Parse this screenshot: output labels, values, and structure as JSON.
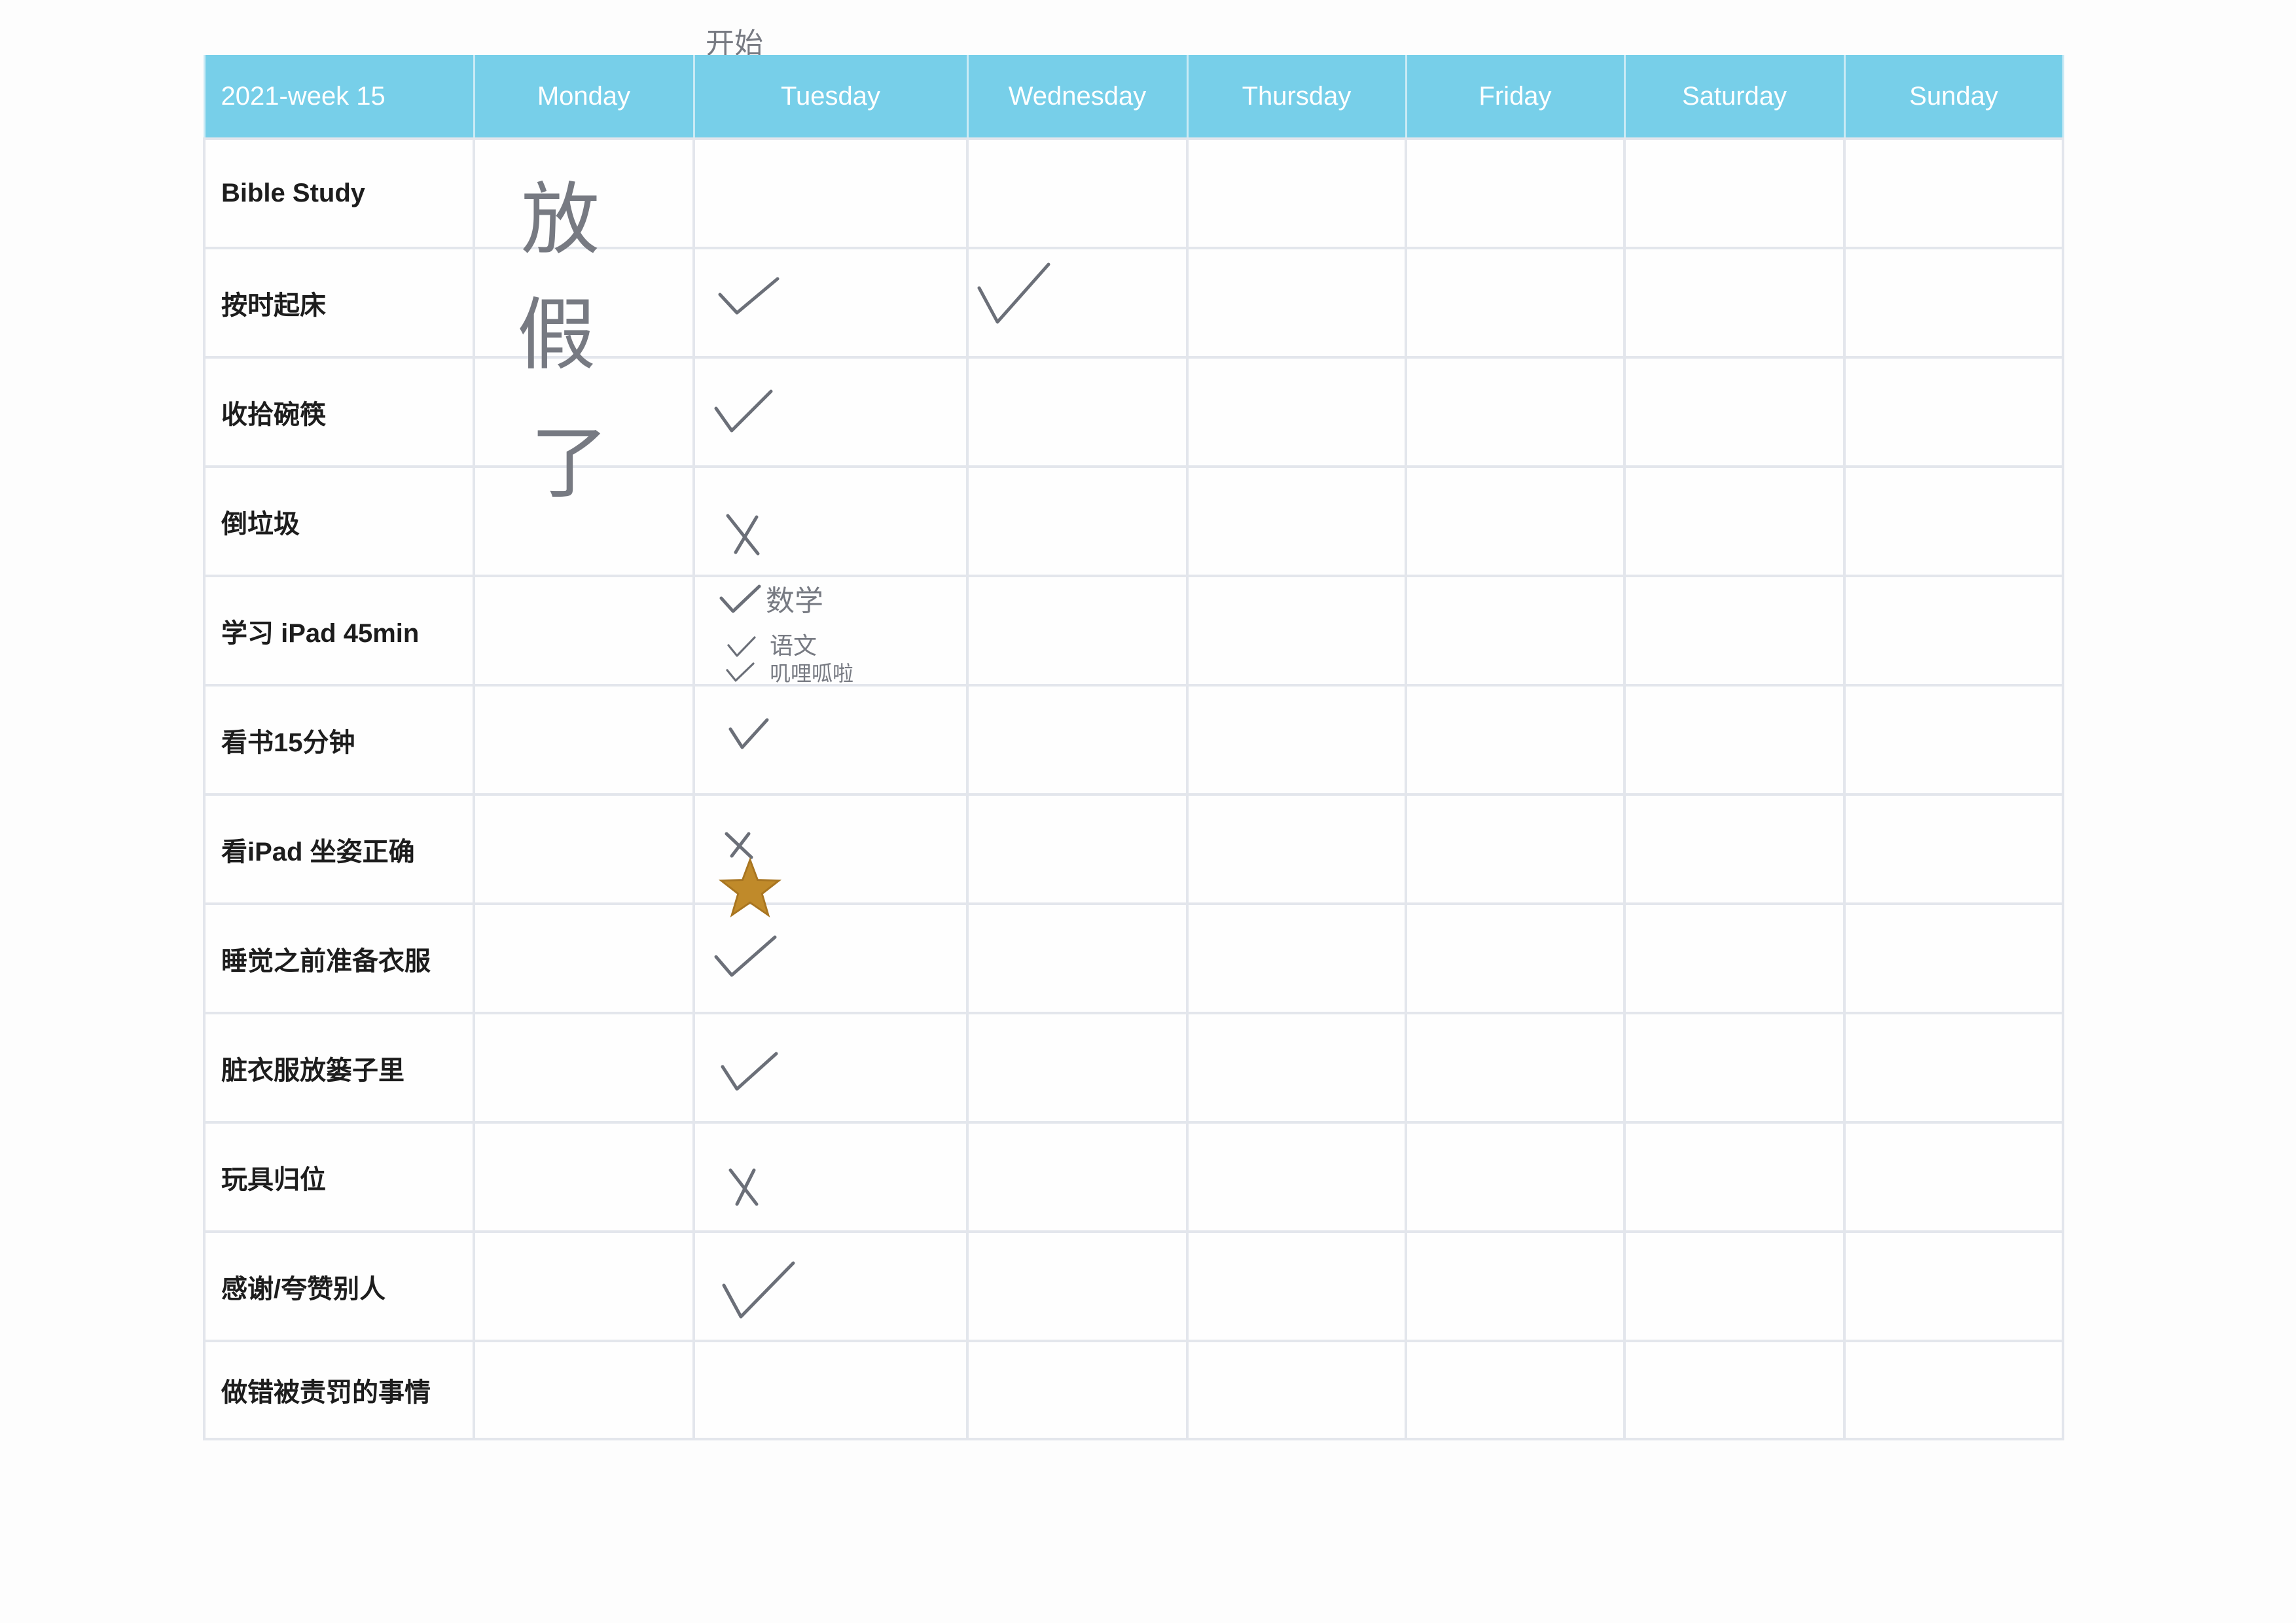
{
  "header": {
    "week": "2021-week 15",
    "days": [
      "Monday",
      "Tuesday",
      "Wednesday",
      "Thursday",
      "Friday",
      "Saturday",
      "Sunday"
    ]
  },
  "handwriting": {
    "top_note": "开始",
    "monday_note": [
      "放",
      "假",
      "了"
    ],
    "ipad_subjects": [
      "数学",
      "语文",
      "叽哩呱啦"
    ]
  },
  "rows": [
    {
      "label": "Bible Study",
      "monday": "放",
      "tuesday": "",
      "wednesday": ""
    },
    {
      "label": " 按时起床",
      "monday": "假",
      "tuesday": "check",
      "wednesday": "check"
    },
    {
      "label": "收拾碗筷",
      "monday": "了",
      "tuesday": "check",
      "wednesday": ""
    },
    {
      "label": "倒垃圾",
      "monday": "",
      "tuesday": "cross",
      "wednesday": ""
    },
    {
      "label": "学习 iPad 45min",
      "monday": "",
      "tuesday": "check x3",
      "wednesday": ""
    },
    {
      "label": "看书15分钟",
      "monday": "",
      "tuesday": "check",
      "wednesday": ""
    },
    {
      "label": "看iPad 坐姿正确",
      "monday": "",
      "tuesday": "cross + star",
      "wednesday": ""
    },
    {
      "label": "睡觉之前准备衣服",
      "monday": "",
      "tuesday": "check",
      "wednesday": ""
    },
    {
      "label": "脏衣服放篓子里",
      "monday": "",
      "tuesday": "check",
      "wednesday": ""
    },
    {
      "label": "玩具归位",
      "monday": "",
      "tuesday": "cross",
      "wednesday": ""
    },
    {
      "label": "感谢/夸赞别人",
      "monday": "",
      "tuesday": "check",
      "wednesday": ""
    },
    {
      "label": "做错被责罚的事情",
      "monday": "",
      "tuesday": "",
      "wednesday": ""
    }
  ],
  "colors": {
    "header_bg": "#77cfe9",
    "header_text": "#ffffff",
    "grid_line": "#e3e6ec",
    "pencil": "#6b6f78",
    "star": "#c08a2a"
  },
  "icons": [
    "check-mark-icon",
    "cross-mark-icon",
    "star-sticker-icon"
  ]
}
